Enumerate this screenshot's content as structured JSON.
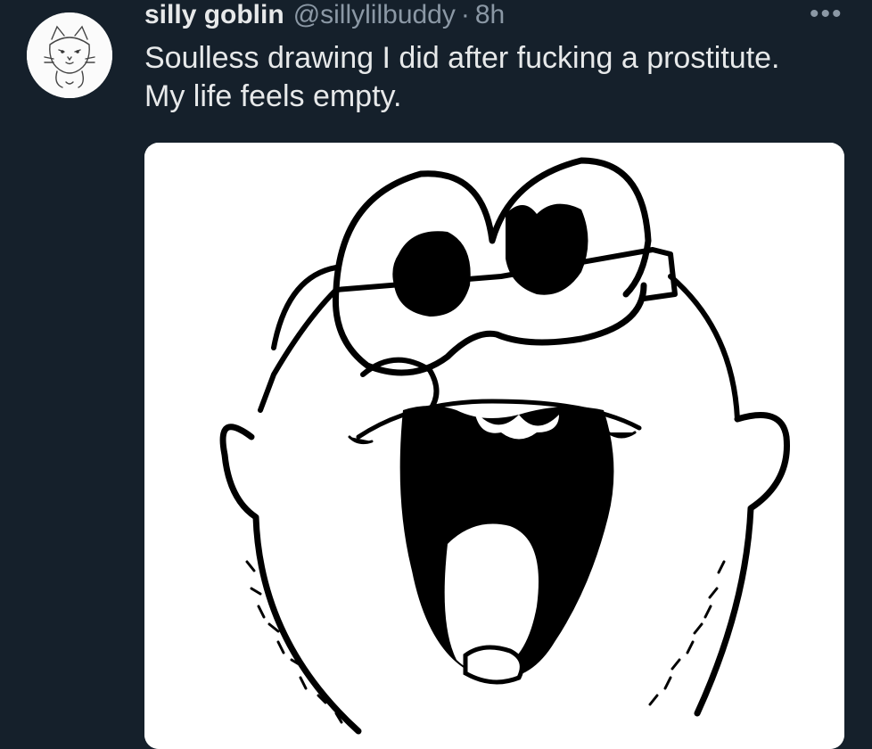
{
  "tweet": {
    "author_name": "silly goblin",
    "handle": "@sillylilbuddy",
    "separator": "·",
    "time": "8h",
    "text": "Soulless drawing I did after fucking a prostitute. My life feels empty.",
    "more_icon": "•••"
  },
  "icons": {
    "avatar": "cat-sketch-avatar",
    "more": "more-options-icon",
    "media": "cartoon-face-drawing"
  },
  "colors": {
    "background": "#15202b",
    "text_primary": "#e7e9ea",
    "text_secondary": "#8b98a5",
    "media_background": "#ffffff"
  }
}
